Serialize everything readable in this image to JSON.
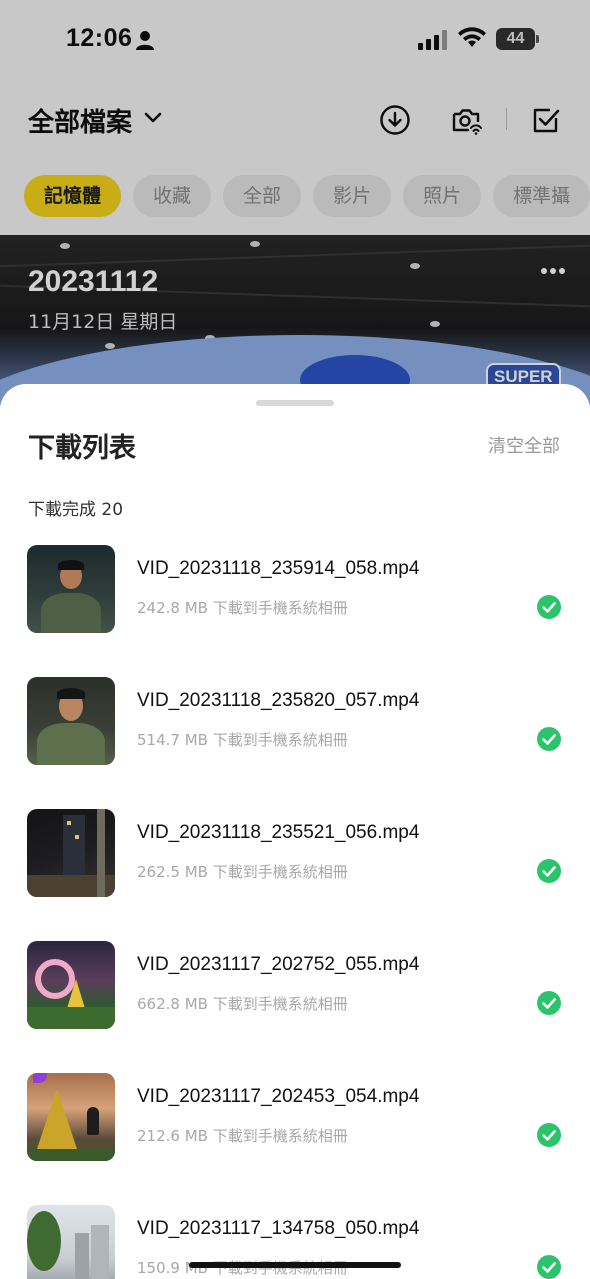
{
  "status_bar": {
    "time": "12:06",
    "battery": "44"
  },
  "header": {
    "folder_title": "全部檔案"
  },
  "filter_chips": [
    {
      "label": "記憶體",
      "active": true
    },
    {
      "label": "收藏",
      "active": false
    },
    {
      "label": "全部",
      "active": false
    },
    {
      "label": "影片",
      "active": false
    },
    {
      "label": "照片",
      "active": false
    },
    {
      "label": "標準攝",
      "active": false
    }
  ],
  "album": {
    "date_title": "20231112",
    "date_sub": "11月12日 星期日",
    "badge": "SUPER"
  },
  "sheet": {
    "title": "下載列表",
    "clear_all": "清空全部",
    "section_label": "下載完成 20",
    "items": [
      {
        "filename": "VID_20231118_235914_058.mp4",
        "size": "242.8 MB",
        "status": "下載到手機系統相冊"
      },
      {
        "filename": "VID_20231118_235820_057.mp4",
        "size": "514.7 MB",
        "status": "下載到手機系統相冊"
      },
      {
        "filename": "VID_20231118_235521_056.mp4",
        "size": "262.5 MB",
        "status": "下載到手機系統相冊"
      },
      {
        "filename": "VID_20231117_202752_055.mp4",
        "size": "662.8 MB",
        "status": "下載到手機系統相冊"
      },
      {
        "filename": "VID_20231117_202453_054.mp4",
        "size": "212.6 MB",
        "status": "下載到手機系統相冊"
      },
      {
        "filename": "VID_20231117_134758_050.mp4",
        "size": "150.9 MB",
        "status": "下載到手機系統相冊"
      }
    ]
  },
  "colors": {
    "accent_yellow": "#f4d31c",
    "success_green": "#2bc46b"
  }
}
